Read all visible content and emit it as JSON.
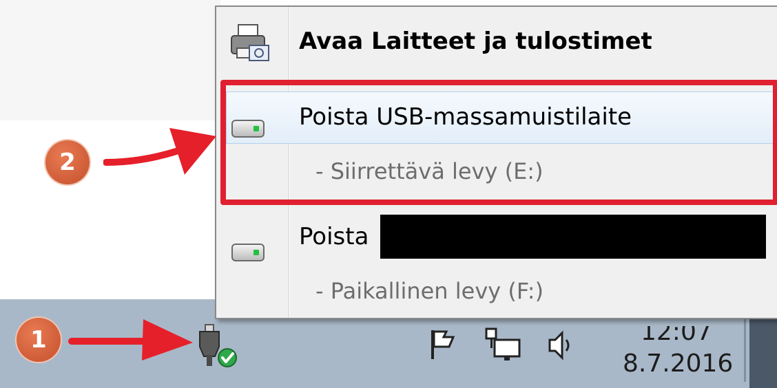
{
  "menu": {
    "items": [
      {
        "label": "Avaa Laitteet ja tulostimet",
        "icon": "printer-icon"
      },
      {
        "label": "Poista USB-massamuistilaite",
        "sub": "- Siirrettävä levy (E:)",
        "icon": "usb-drive-icon"
      },
      {
        "label": "Poista",
        "sub": "- Paikallinen levy (F:)",
        "icon": "local-drive-icon"
      }
    ]
  },
  "annotations": {
    "badge_1": "1",
    "badge_2": "2",
    "highlight_color": "#e02030",
    "badge_color": "#d45d36"
  },
  "tray": {
    "time": "12:07",
    "date": "8.7.2016",
    "icons": [
      "safely-remove-hardware-icon",
      "action-center-flag-icon",
      "network-icon",
      "volume-icon"
    ]
  }
}
